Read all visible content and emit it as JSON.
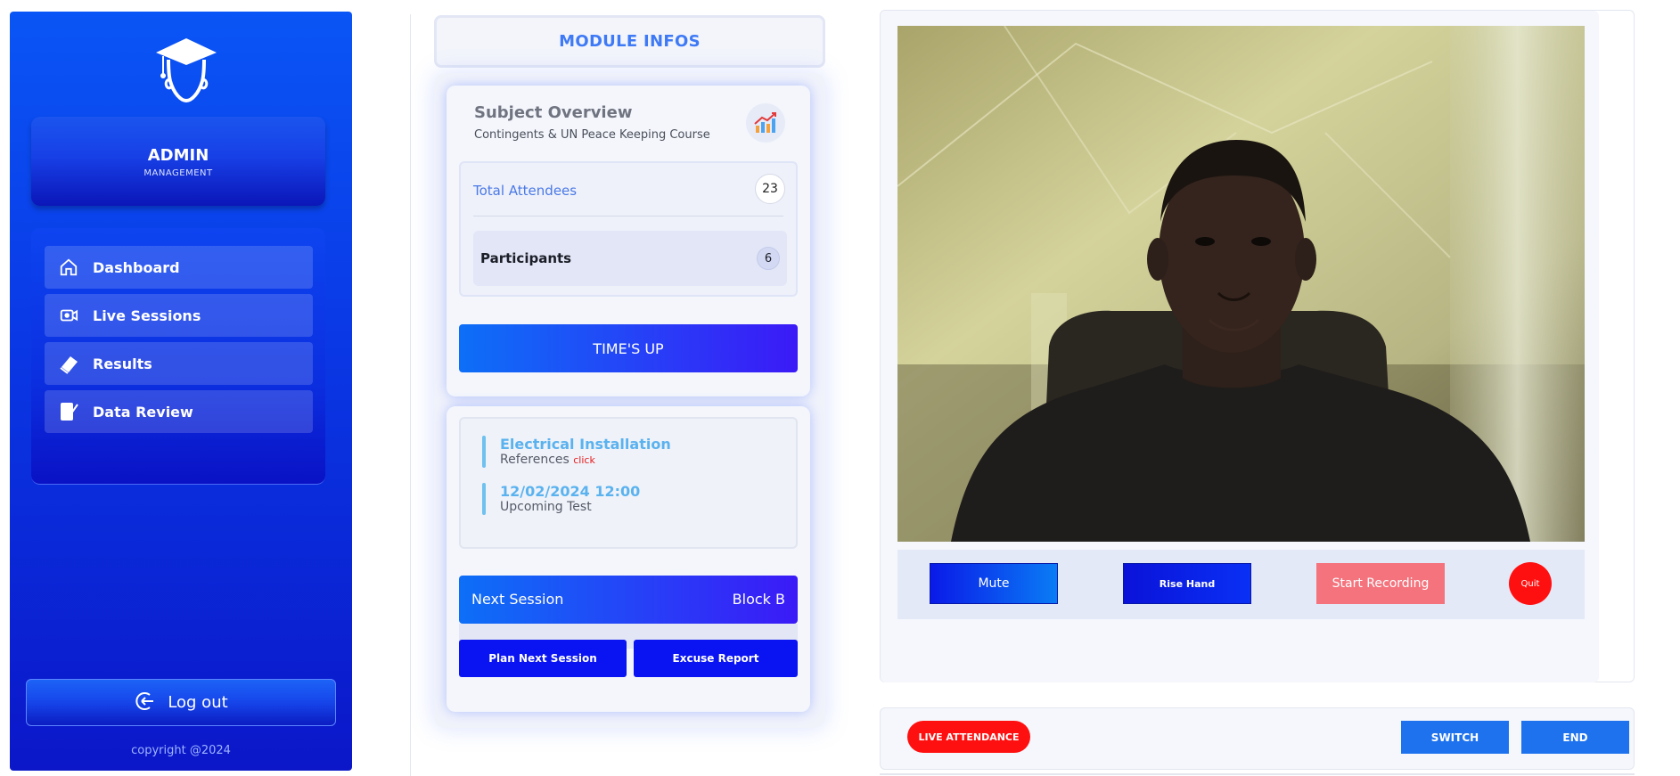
{
  "sidebar": {
    "admin_title": "ADMIN",
    "admin_subtitle": "MANAGEMENT",
    "items": [
      {
        "label": "Dashboard",
        "icon": "home-icon"
      },
      {
        "label": "Live Sessions",
        "icon": "live-session-icon"
      },
      {
        "label": "Results",
        "icon": "book-icon"
      },
      {
        "label": "Data Review",
        "icon": "edit-document-icon"
      }
    ],
    "logout_label": "Log out",
    "copyright": "copyright @2024"
  },
  "module": {
    "header": "MODULE INFOS",
    "overview_title": "Subject Overview",
    "overview_subtitle": "Contingents & UN Peace Keeping Course",
    "total_attendees_label": "Total Attendees",
    "total_attendees_count": "23",
    "participants_label": "Participants",
    "participants_count": "6",
    "times_up_label": "TIME'S UP",
    "info_items": [
      {
        "title": "Electrical Installation",
        "subtitle": "References",
        "link": "click"
      },
      {
        "title": "12/02/2024 12:00",
        "subtitle": "Upcoming Test"
      }
    ],
    "next_session_label": "Next Session",
    "next_session_value": "Block B",
    "plan_button": "Plan Next Session",
    "excuse_button": "Excuse Report"
  },
  "video": {
    "controls": {
      "mute": "Mute",
      "raise_hand": "Rise Hand",
      "start_recording": "Start Recording",
      "quit": "Quit"
    }
  },
  "bottom_bar": {
    "live_attendance": "LIVE ATTENDANCE",
    "switch": "SWITCH",
    "end": "END"
  },
  "colors": {
    "sidebar_top": "#0a55f5",
    "sidebar_bottom": "#0b17c9",
    "accent_blue": "#3f7af6",
    "danger_red": "#ff1010",
    "recording_pink": "#f4737d"
  }
}
